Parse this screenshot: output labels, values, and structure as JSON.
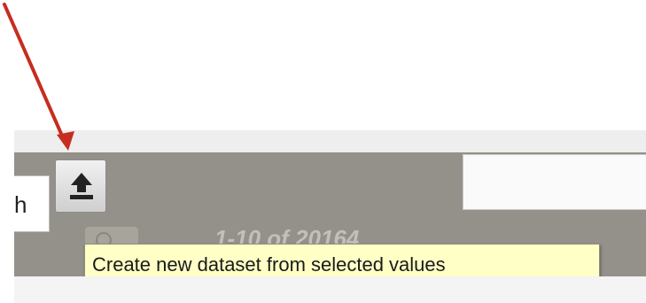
{
  "left_input": {
    "value": "h"
  },
  "upload_button": {
    "icon": "upload-icon"
  },
  "pagination": {
    "text": "1-10 of 20164"
  },
  "tooltip": {
    "text": "Create new dataset from selected values"
  },
  "annotation": {
    "icon": "red-arrow-icon",
    "color": "#c62d1f"
  },
  "colors": {
    "toolbar": "#939189",
    "tooltip_bg": "#ffffc6"
  }
}
